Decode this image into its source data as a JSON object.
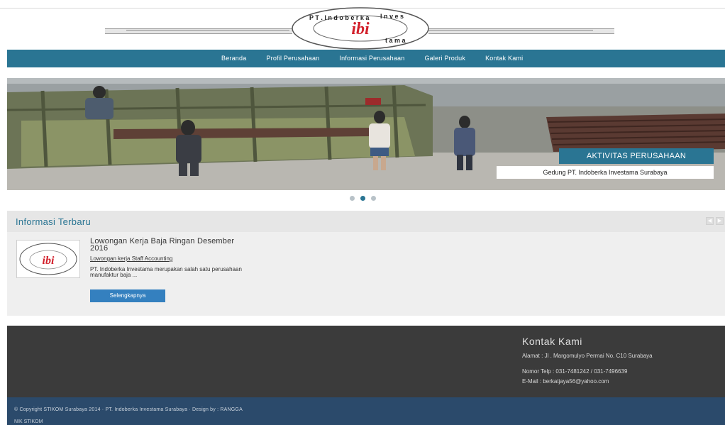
{
  "logo": {
    "text": "ibi",
    "ring_text": "PT. Indoberka Investama"
  },
  "nav": {
    "items": [
      "Beranda",
      "Profil Perusahaan",
      "Informasi Perusahaan",
      "Galeri Produk",
      "Kontak Kami"
    ]
  },
  "slider": {
    "caption_title": "AKTIVITAS PERUSAHAAN",
    "caption_subtitle": "Gedung PT. Indoberka Investama Surabaya",
    "slide_count": 3,
    "active_slide": 2
  },
  "info": {
    "title": "Informasi Terbaru",
    "post": {
      "title": "Lowongan Kerja Baja Ringan Desember 2016",
      "link": "Lowongan kerja Staff Accounting",
      "excerpt": "PT. Indoberka Investama merupakan salah satu perusahaan manufaktur baja ...",
      "button": "Selengkapnya"
    }
  },
  "footer": {
    "contact_title": "Kontak Kami",
    "address": "Alamat : Jl . Margomulyo Permai No. C10 Surabaya",
    "phone": "Nomor Telp : 031-7481242 / 031-7496639",
    "email": "E-Mail : berkatjaya56@yahoo.com"
  },
  "copyright": {
    "text": "© Copyright STIKOM Surabaya 2014 · PT. Indoberka Investama Surabaya · Design by : RANGGA",
    "sub": "NIK STIKOM"
  },
  "colors": {
    "primary": "#2a7593",
    "footer": "#3b3b3b",
    "copyright": "#2b4a6b",
    "button": "#3480bf"
  }
}
